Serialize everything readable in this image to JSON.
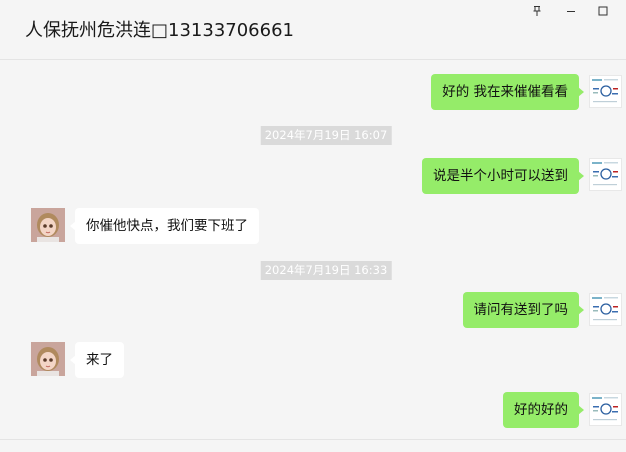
{
  "window": {
    "title": "人保抚州危洪连□13133706661",
    "controls": [
      "pin-icon",
      "minimize-icon",
      "maximize-icon"
    ]
  },
  "messages": [
    {
      "side": "me",
      "text": "好的  我在来催催看看"
    },
    {
      "type": "time",
      "text": "2024年7月19日 16:07"
    },
    {
      "side": "me",
      "text": "说是半个小时可以送到"
    },
    {
      "side": "them",
      "text": "你催他快点，我们要下班了"
    },
    {
      "type": "time",
      "text": "2024年7月19日 16:33"
    },
    {
      "side": "me",
      "text": "请问有送到了吗"
    },
    {
      "side": "them",
      "text": "来了"
    },
    {
      "side": "me",
      "text": "好的好的"
    }
  ],
  "colors": {
    "my_bubble": "#95ec69",
    "their_bubble": "#ffffff",
    "background": "#f5f5f5",
    "timestamp_bg": "#dadada"
  }
}
